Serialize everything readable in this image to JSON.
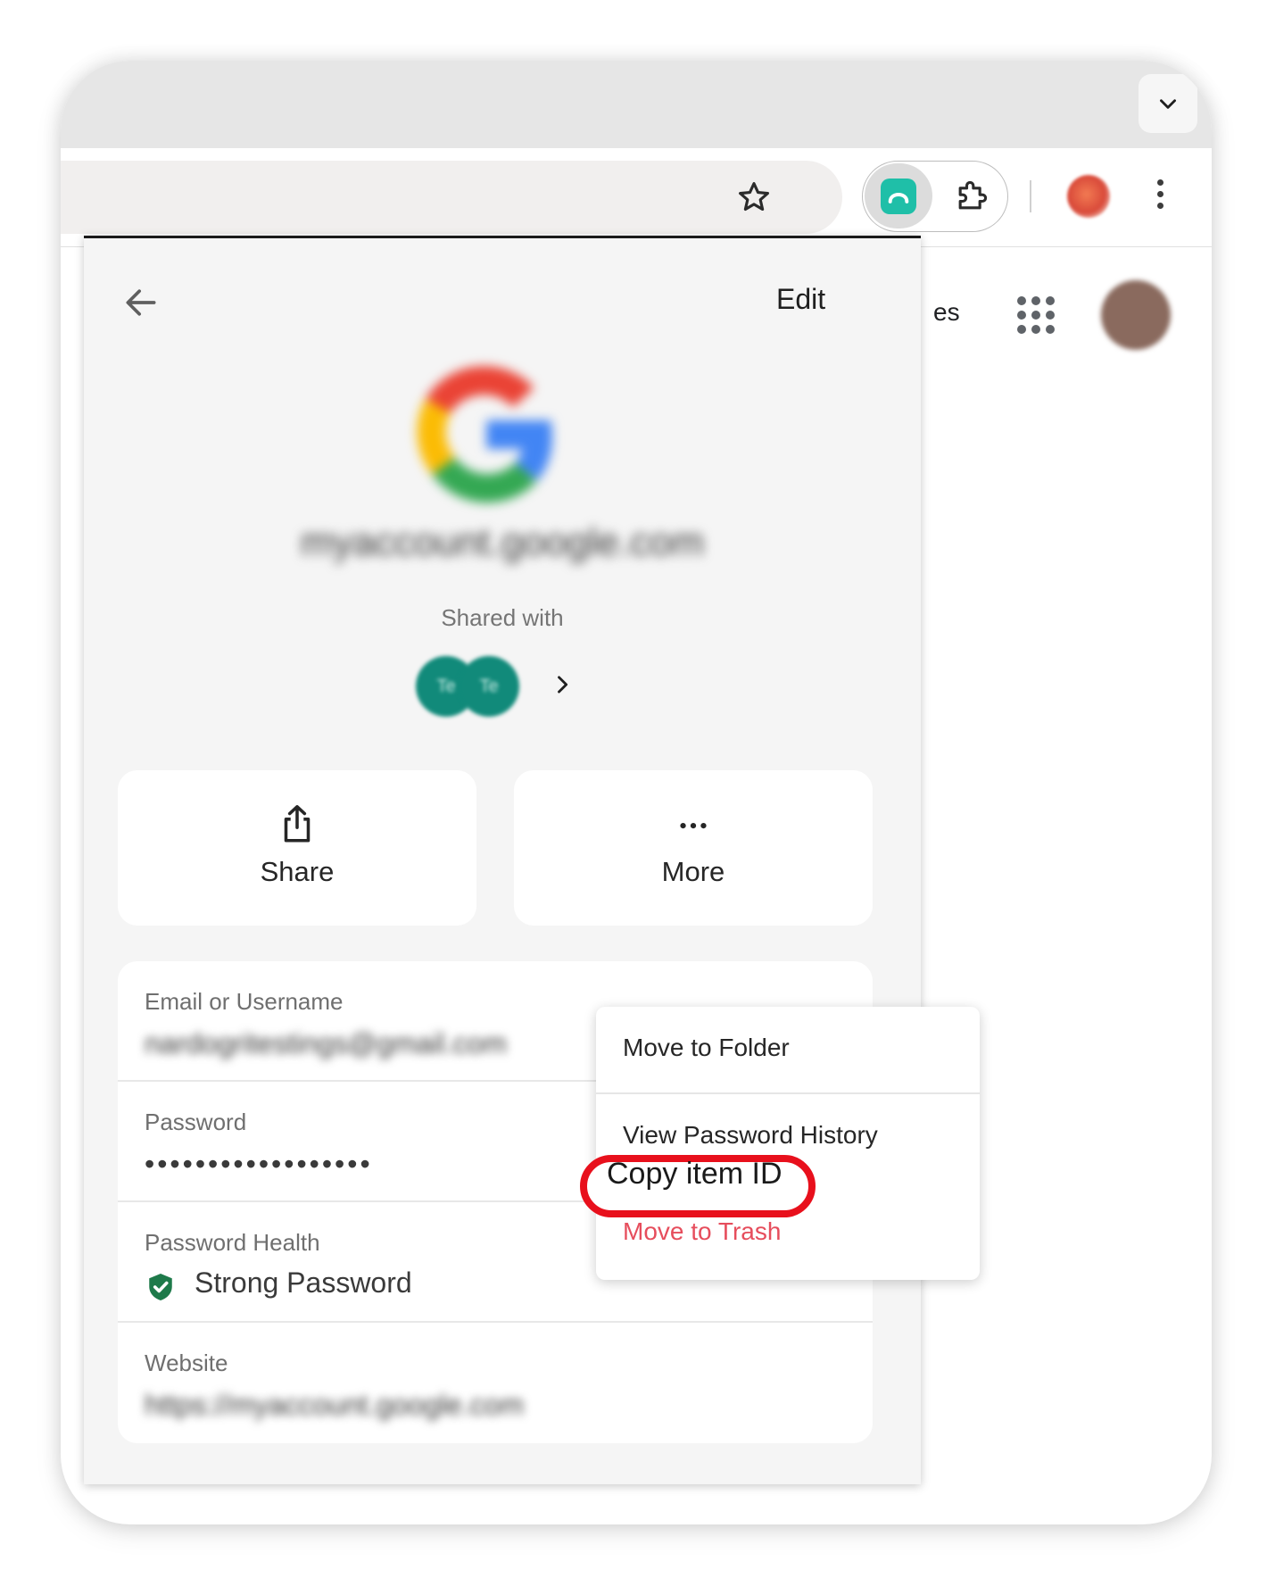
{
  "browser": {
    "background_text": "es"
  },
  "popup": {
    "edit_label": "Edit",
    "site_title": "myaccount.google.com",
    "shared_with_label": "Shared with",
    "shared_avatars": [
      "Te",
      "Te"
    ],
    "actions": {
      "share_label": "Share",
      "more_label": "More"
    },
    "fields": {
      "email_label": "Email or Username",
      "email_value": "nardogritestings@gmail.com",
      "password_label": "Password",
      "password_value": "••••••••••••••••••",
      "health_label": "Password Health",
      "health_value": "Strong Password",
      "website_label": "Website",
      "website_value": "https://myaccount.google.com"
    }
  },
  "menu": {
    "move_to_folder": "Move to Folder",
    "view_password_history": "View Password History",
    "copy_item_id": "Copy item ID",
    "move_to_trash": "Move to Trash"
  },
  "colors": {
    "accent_green": "#1e7a4a",
    "danger": "#e64d5c",
    "highlight_ring": "#e8101c",
    "extension_teal": "#1fbfa8"
  }
}
